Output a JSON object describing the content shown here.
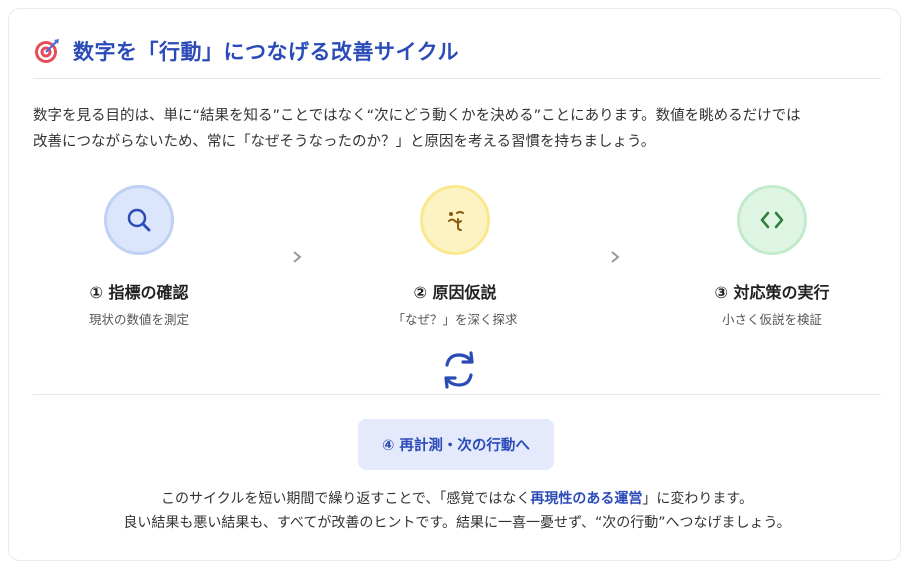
{
  "header": {
    "icon": "target-icon",
    "title": "数字を「行動」につなげる改善サイクル"
  },
  "intro": {
    "line1": "数字を見る目的は、単に“結果を知る”ことではなく“次にどう動くかを決める”ことにあります。数値を眺めるだけでは",
    "line2": "改善につながらないため、常に「なぜそうなったのか？」と原因を考える習慣を持ちましょう。"
  },
  "steps": [
    {
      "icon": "search-icon",
      "label": "① 指標の確認",
      "sub": "現状の数値を測定",
      "color": "#dbe5fb"
    },
    {
      "icon": "thinking-face-icon",
      "label": "② 原因仮説",
      "sub": "「なぜ？」を深く探求",
      "color": "#fdf3c2"
    },
    {
      "icon": "code-brackets-icon",
      "label": "③ 対応策の実行",
      "sub": "小さく仮説を検証",
      "color": "#dff5e3"
    }
  ],
  "cycle_icon": "refresh-cycle-icon",
  "recheck": {
    "label": "④ 再計測・次の行動へ"
  },
  "outro": {
    "line1_pre": "このサイクルを短い期間で繰り返すことで、「感覚ではなく",
    "line1_em": "再現性のある運営",
    "line1_post": "」に変わります。",
    "line2": "良い結果も悪い結果も、すべてが改善のヒントです。結果に一喜一憂せず、“次の行動”へつなげましょう。"
  },
  "colors": {
    "accent": "#2b4bb8",
    "text": "#333333"
  }
}
